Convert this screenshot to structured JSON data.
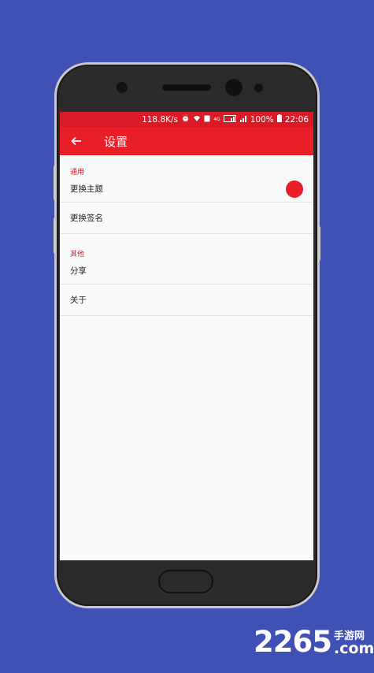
{
  "statusbar": {
    "speed": "118.8K/s",
    "network": "4G",
    "battery": "100%",
    "time": "22:06"
  },
  "appbar": {
    "back_icon": "arrow-left-icon",
    "title": "设置"
  },
  "sections": {
    "general": {
      "header": "通用",
      "change_theme": "更换主题",
      "theme_color": "#e91e26",
      "change_signature": "更换签名"
    },
    "other": {
      "header": "其他",
      "share": "分享",
      "about": "关于"
    }
  },
  "watermark": {
    "number": "2265",
    "cn": "手游网",
    "com": ".com"
  }
}
